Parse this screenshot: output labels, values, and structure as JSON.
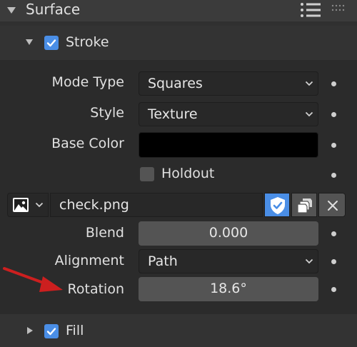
{
  "surface": {
    "title": "Surface"
  },
  "stroke": {
    "title": "Stroke",
    "enabled": true,
    "mode_type": {
      "label": "Mode Type",
      "value": "Squares"
    },
    "style": {
      "label": "Style",
      "value": "Texture"
    },
    "base_color": {
      "label": "Base Color",
      "value": "#000000"
    },
    "holdout": {
      "label": "Holdout",
      "checked": false
    },
    "image": {
      "name": "check.png",
      "fake_user": true
    },
    "blend": {
      "label": "Blend",
      "value": "0.000"
    },
    "alignment": {
      "label": "Alignment",
      "value": "Path"
    },
    "rotation": {
      "label": "Rotation",
      "value": "18.6°"
    }
  },
  "fill": {
    "title": "Fill",
    "enabled": true,
    "expanded": false
  },
  "colors": {
    "accent": "#4a8ee6",
    "annotation_arrow": "#cc1f1f"
  },
  "icons": [
    "list-icon",
    "grip-icon",
    "image-icon",
    "fake-user-shield-icon",
    "duplicate-icon",
    "close-icon",
    "chevron-down-icon",
    "checkmark-icon"
  ]
}
